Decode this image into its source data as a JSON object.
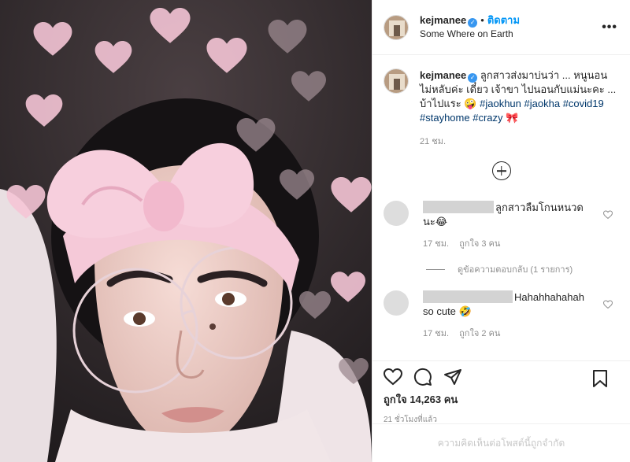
{
  "header": {
    "username": "kejmanee",
    "separator": "•",
    "follow_label": "ติดตาม",
    "location": "Some Where on Earth",
    "more": "•••"
  },
  "caption": {
    "username": "kejmanee",
    "text": "ลูกสาวส่งมาบ่นว่า ... หนูนอนไม่หลับค่ะ เดี๋ยว เจ้าขา ไปนอนกับแม่นะคะ ... บ้าไปแระ 🤪",
    "hashtags": [
      "#jaokhun",
      "#jaokha",
      "#covid19",
      "#stayhome",
      "#crazy"
    ],
    "emoji_end": "🎀",
    "time": "21 ชม."
  },
  "comments": [
    {
      "text": "ลูกสาวลืมโกนหนวดนะ😂",
      "time": "17 ชม.",
      "likes": "ถูกใจ 3 คน",
      "replies": "ดูข้อความตอบกลับ (1 รายการ)"
    },
    {
      "text": "Hahahhahahah so cute 🤣",
      "time": "17 ชม.",
      "likes": "ถูกใจ 2 คน"
    }
  ],
  "likes": "ถูกใจ 14,263 คน",
  "timestamp": "21 ชั่วโมงที่แล้ว",
  "comments_disabled": "ความคิดเห็นต่อโพสต์นี้ถูกจำกัด",
  "colors": {
    "accent": "#0095f6",
    "verified": "#3897f0",
    "hashtag": "#00376b",
    "muted": "#8e8e8e"
  }
}
